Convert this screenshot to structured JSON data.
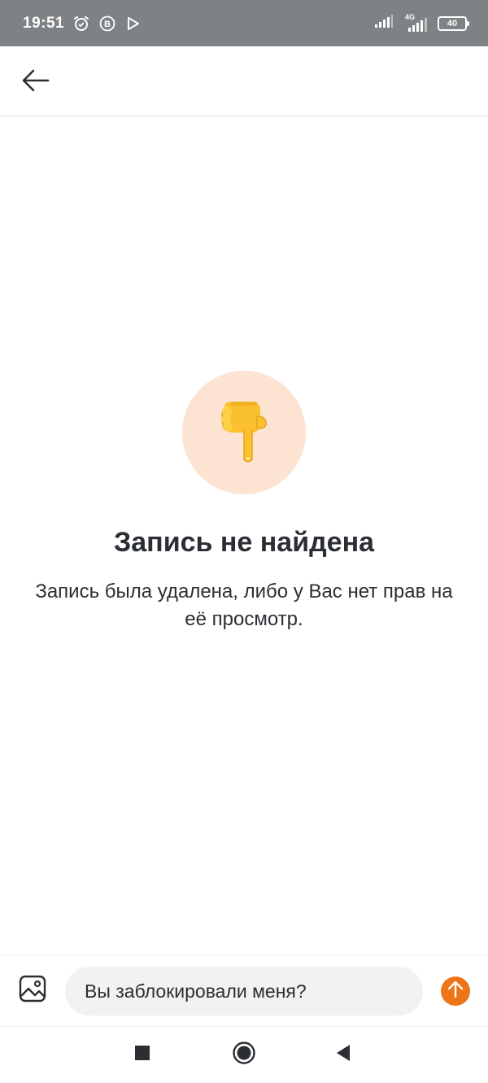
{
  "status_bar": {
    "time": "19:51",
    "left_icons": [
      "alarm-icon",
      "b-badge-icon",
      "play-store-icon"
    ],
    "right_icons": [
      "signal-icon",
      "signal-4g-icon"
    ],
    "network_label": "4G",
    "battery_level": "40"
  },
  "header": {
    "back_icon": "arrow-left-icon"
  },
  "empty_state": {
    "emoji_icon": "pointing-down-hand-icon",
    "title": "Запись не найдена",
    "description": "Запись была удалена, либо у Вас нет прав на её просмотр."
  },
  "composer": {
    "attach_icon": "image-icon",
    "input_value": "Вы заблокировали меня?",
    "send_icon": "arrow-up-icon"
  },
  "nav_bar": {
    "items": [
      "recents-square-icon",
      "home-circle-icon",
      "back-triangle-icon"
    ]
  },
  "colors": {
    "accent": "#ee7418",
    "emoji_bg": "#fde3d2",
    "status_bar_bg": "#7f8285",
    "text": "#2b2e33",
    "input_bg": "#f2f2f3"
  }
}
